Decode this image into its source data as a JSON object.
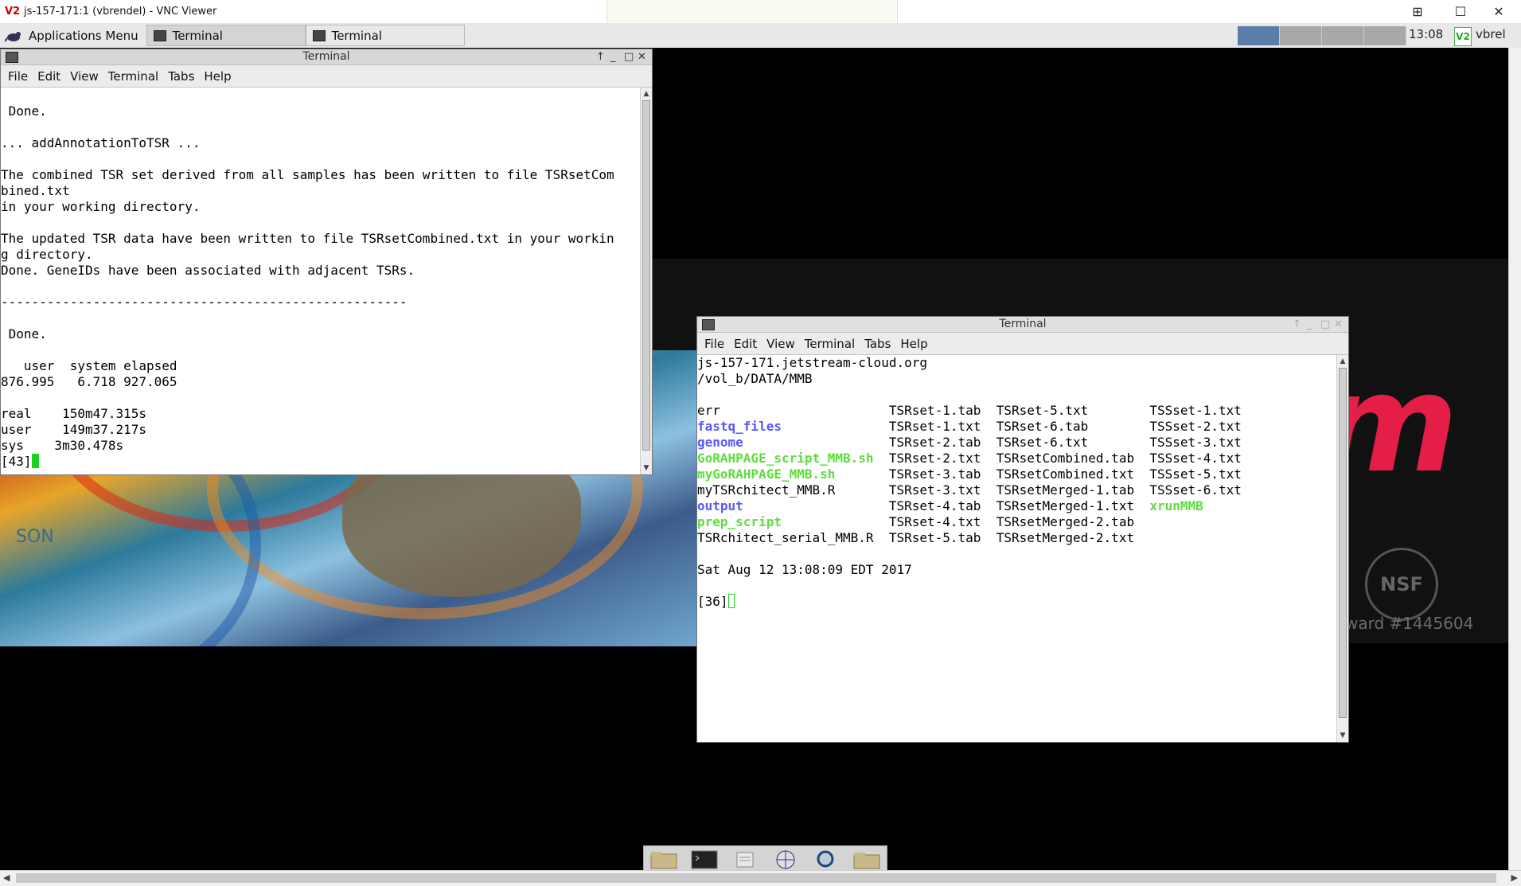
{
  "vnc": {
    "title": "js-157-171:1 (vbrendel) - VNC Viewer",
    "icon": "V2",
    "controls": [
      "⊞",
      "☐",
      "✕"
    ]
  },
  "panel": {
    "apps_menu": "Applications Menu",
    "tasks": [
      "Terminal",
      "Terminal"
    ],
    "clock": "13:08",
    "vnc_icon": "V2",
    "user": "vbrel"
  },
  "term1": {
    "title": "Terminal",
    "menu": [
      "File",
      "Edit",
      "View",
      "Terminal",
      "Tabs",
      "Help"
    ],
    "lines": [
      "",
      " Done.",
      "",
      "... addAnnotationToTSR ...",
      "",
      "The combined TSR set derived from all samples has been written to file TSRsetCom",
      "bined.txt",
      "in your working directory.",
      "",
      "The updated TSR data have been written to file TSRsetCombined.txt in your workin",
      "g directory.",
      "Done. GeneIDs have been associated with adjacent TSRs.",
      "",
      "-----------------------------------------------------",
      "",
      " Done.",
      "",
      "   user  system elapsed",
      "876.995   6.718 927.065",
      "",
      "real\t150m47.315s",
      "user\t149m37.217s",
      "sys\t3m30.478s"
    ],
    "prompt": "[43]"
  },
  "term2": {
    "title": "Terminal",
    "menu": [
      "File",
      "Edit",
      "View",
      "Terminal",
      "Tabs",
      "Help"
    ],
    "host": "js-157-171.jetstream-cloud.org",
    "cwd": "/vol_b/DATA/MMB",
    "listing": [
      [
        {
          "t": "err",
          "k": ""
        },
        {
          "t": "TSRset-1.tab",
          "k": ""
        },
        {
          "t": "TSRset-5.txt",
          "k": ""
        },
        {
          "t": "TSSset-1.txt",
          "k": ""
        }
      ],
      [
        {
          "t": "fastq_files",
          "k": "dir"
        },
        {
          "t": "TSRset-1.txt",
          "k": ""
        },
        {
          "t": "TSRset-6.tab",
          "k": ""
        },
        {
          "t": "TSSset-2.txt",
          "k": ""
        }
      ],
      [
        {
          "t": "genome",
          "k": "dir"
        },
        {
          "t": "TSRset-2.tab",
          "k": ""
        },
        {
          "t": "TSRset-6.txt",
          "k": ""
        },
        {
          "t": "TSSset-3.txt",
          "k": ""
        }
      ],
      [
        {
          "t": "GoRAHPAGE_script_MMB.sh",
          "k": "exe"
        },
        {
          "t": "TSRset-2.txt",
          "k": ""
        },
        {
          "t": "TSRsetCombined.tab",
          "k": ""
        },
        {
          "t": "TSSset-4.txt",
          "k": ""
        }
      ],
      [
        {
          "t": "myGoRAHPAGE_MMB.sh",
          "k": "exe"
        },
        {
          "t": "TSRset-3.tab",
          "k": ""
        },
        {
          "t": "TSRsetCombined.txt",
          "k": ""
        },
        {
          "t": "TSSset-5.txt",
          "k": ""
        }
      ],
      [
        {
          "t": "myTSRchitect_MMB.R",
          "k": ""
        },
        {
          "t": "TSRset-3.txt",
          "k": ""
        },
        {
          "t": "TSRsetMerged-1.tab",
          "k": ""
        },
        {
          "t": "TSSset-6.txt",
          "k": ""
        }
      ],
      [
        {
          "t": "output",
          "k": "dir"
        },
        {
          "t": "TSRset-4.tab",
          "k": ""
        },
        {
          "t": "TSRsetMerged-1.txt",
          "k": ""
        },
        {
          "t": "xrunMMB",
          "k": "exe"
        }
      ],
      [
        {
          "t": "prep_script",
          "k": "exe"
        },
        {
          "t": "TSRset-4.txt",
          "k": ""
        },
        {
          "t": "TSRsetMerged-2.tab",
          "k": ""
        },
        {
          "t": "",
          "k": ""
        }
      ],
      [
        {
          "t": "TSRchitect_serial_MMB.R",
          "k": ""
        },
        {
          "t": "TSRset-5.tab",
          "k": ""
        },
        {
          "t": "TSRsetMerged-2.txt",
          "k": ""
        },
        {
          "t": "",
          "k": ""
        }
      ]
    ],
    "date": "Sat Aug 12 13:08:09 EDT 2017",
    "prompt": "[36]"
  },
  "wallpaper": {
    "logo_letter": "m",
    "nsf": "NSF",
    "award": "ward #1445604",
    "son": "SON"
  },
  "colors": {
    "dir": "#5757ff",
    "exe": "#5cdd3c",
    "logo": "#e51e48"
  }
}
